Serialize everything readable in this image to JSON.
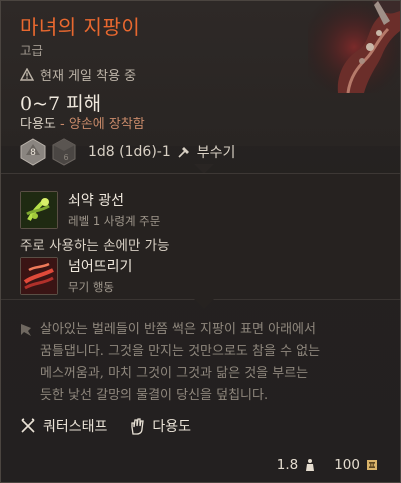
{
  "item": {
    "name": "마녀의 지팡이",
    "rarity": "고급",
    "status_warning": "현재 게일 착용 중",
    "damage": "0~7 피해",
    "proficiency": "다용도",
    "proficiency_separator": "-",
    "proficiency_note": "양손에 장착함",
    "dice_formula": "1d8 (1d6)-1",
    "damage_type": "부수기",
    "dice": [
      {
        "label": "8",
        "color": "#8a8580"
      },
      {
        "label": "6",
        "color": "#4a4643"
      }
    ]
  },
  "actions": [
    {
      "name": "쇠약 광선",
      "sub": "레벨 1 사령계 주문",
      "icon": "ray-of-sickness-icon"
    },
    {
      "name": "넘어뜨리기",
      "sub": "무기 행동",
      "icon": "topple-icon"
    }
  ],
  "mainhand_note": "주로 사용하는 손에만 가능",
  "flavor_lines": [
    "살아있는 벌레들이 반쯤 썩은 지팡이 표면 아래에서",
    "꿈틀댑니다. 그것을 만지는 것만으로도 참을 수 없는",
    "메스꺼움과, 마치 그것이 그것과 닮은 것을 부르는",
    "듯한 낯선 갈망의 물결이 당신을 덮칩니다."
  ],
  "tags": [
    {
      "label": "쿼터스태프",
      "icon": "quarterstaff-icon"
    },
    {
      "label": "다용도",
      "icon": "versatile-hand-icon"
    }
  ],
  "footer": {
    "weight": "1.8",
    "value": "100"
  },
  "colors": {
    "title": "#e9682f",
    "accent_sub": "#c98a6a",
    "gold": "#d9b36a"
  }
}
